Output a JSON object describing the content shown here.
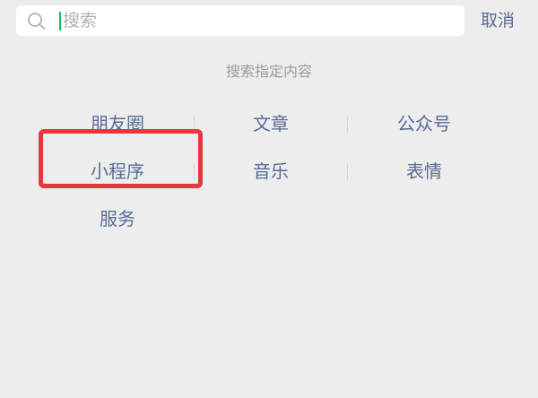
{
  "search": {
    "value": "",
    "placeholder": "搜索"
  },
  "header": {
    "cancel_label": "取消"
  },
  "section": {
    "title": "搜索指定内容"
  },
  "categories": [
    {
      "label": "朋友圈"
    },
    {
      "label": "文章"
    },
    {
      "label": "公众号"
    },
    {
      "label": "小程序"
    },
    {
      "label": "音乐"
    },
    {
      "label": "表情"
    },
    {
      "label": "服务"
    }
  ],
  "colors": {
    "background": "#ededed",
    "link": "#576b95",
    "caret": "#07c160",
    "highlight": "#e23a3c",
    "muted": "#9b9b9b"
  }
}
